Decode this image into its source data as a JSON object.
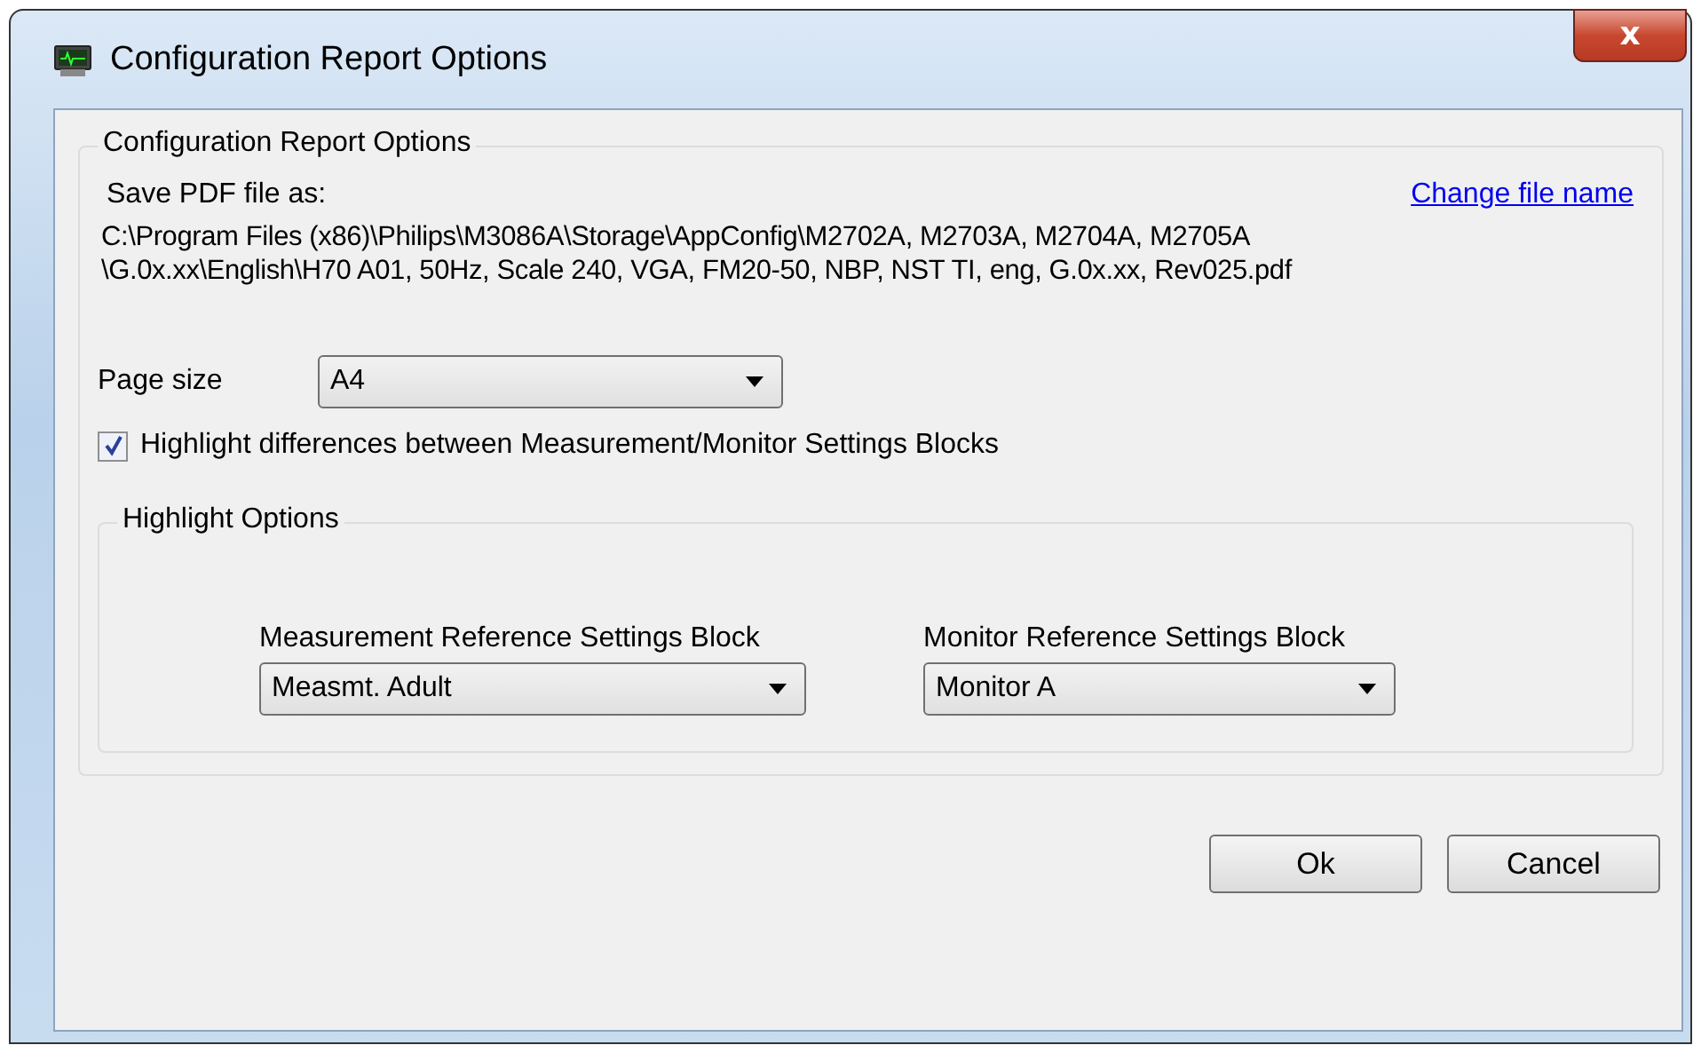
{
  "window": {
    "title": "Configuration Report Options",
    "close": "x"
  },
  "group": {
    "title": "Configuration Report Options",
    "save_label": "Save PDF file as:",
    "change_link": "Change file name",
    "path_lines": [
      "C:\\Program Files (x86)\\Philips\\M3086A\\Storage\\AppConfig\\M2702A, M2703A, M2704A, M2705A",
      "\\G.0x.xx\\English\\H70 A01, 50Hz, Scale 240, VGA, FM20-50, NBP, NST TI, eng, G.0x.xx, Rev025.pdf"
    ],
    "page_size": {
      "label": "Page size",
      "value": "A4"
    },
    "highlight": {
      "label": "Highlight differences between Measurement/Monitor Settings Blocks",
      "checked": true
    },
    "options": {
      "title": "Highlight Options",
      "selects": [
        {
          "label": "Measurement Reference Settings Block",
          "value": "Measmt. Adult"
        },
        {
          "label": "Monitor Reference Settings Block",
          "value": "Monitor A"
        }
      ]
    }
  },
  "buttons": [
    "Ok",
    "Cancel"
  ]
}
